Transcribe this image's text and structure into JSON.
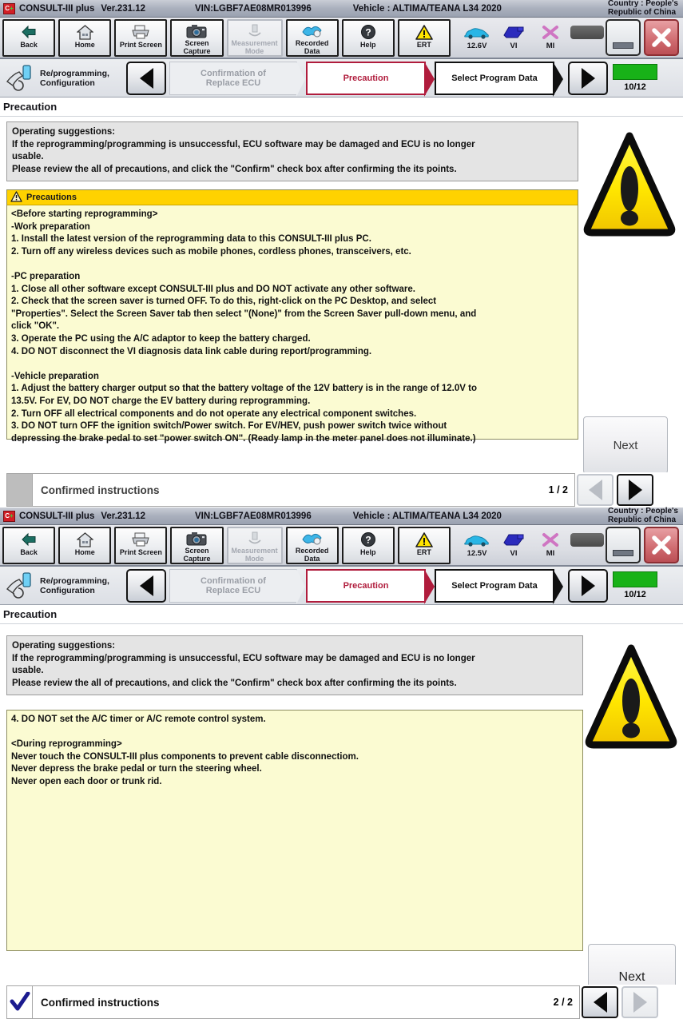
{
  "titlebar": {
    "logo": "c3-logo-icon",
    "app": "CONSULT-III plus",
    "version": "Ver.231.12",
    "vin": "VIN:LGBF7AE08MR013996",
    "vehicle": "Vehicle : ALTIMA/TEANA L34 2020",
    "country_line1": "Country : People's",
    "country_line2": "Republic of China"
  },
  "toolbar": {
    "back": "Back",
    "home": "Home",
    "print_screen": "Print Screen",
    "screen_capture_l1": "Screen",
    "screen_capture_l2": "Capture",
    "measurement_l1": "Measurement",
    "measurement_l2": "Mode",
    "recorded_l1": "Recorded",
    "recorded_l2": "Data",
    "help": "Help",
    "ert": "ERT",
    "voltage_panel1": "12.6V",
    "voltage_panel2": "12.5V",
    "vi": "VI",
    "mi": "MI",
    "minimize": "minimize-button",
    "close": "close-button"
  },
  "flow": {
    "mode_line1": "Re/programming,",
    "mode_line2": "Configuration",
    "prev_label": "previous-step",
    "next_label": "next-step",
    "steps": [
      {
        "line1": "Confirmation of",
        "line2": "Replace ECU",
        "state": "past"
      },
      {
        "line1": "Precaution",
        "line2": "",
        "state": "current"
      },
      {
        "line1": "Select Program Data",
        "line2": "",
        "state": "next"
      }
    ],
    "progress": "10/12",
    "progress_color": "#18b218"
  },
  "page": {
    "title": "Precaution"
  },
  "suggestions": {
    "line1": "Operating  suggestions:",
    "line2": "If the reprogramming/programming is unsuccessful, ECU software may be damaged and ECU is no longer",
    "line3": "usable.",
    "line4": "Please review the all of precautions, and click the \"Confirm\" check box after confirming the its points."
  },
  "precautions": {
    "header": "Precautions",
    "page1": [
      "<Before  starting  reprogramming>",
      "-Work  preparation",
      "1. Install the latest version of the reprogramming data to this CONSULT-III plus PC.",
      "2. Turn off any wireless devices such as mobile phones, cordless phones, transceivers, etc.",
      "",
      "-PC  preparation",
      "1. Close all other software except CONSULT-III plus and DO NOT activate any other software.",
      "2. Check that the screen saver is turned OFF. To do this, right-click on the PC Desktop, and select",
      "\"Properties\". Select the Screen Saver tab then select \"(None)\" from the Screen Saver pull-down menu, and",
      "click \"OK\".",
      "3. Operate the PC using the A/C adaptor to keep the battery charged.",
      "4. DO NOT disconnect the VI diagnosis data link cable during report/programming.",
      "",
      "-Vehicle  preparation",
      "1. Adjust the battery charger output so that the battery voltage of the 12V battery is in the range of 12.0V to",
      "13.5V. For EV, DO NOT charge the EV battery during reprogramming.",
      "2. Turn OFF all electrical components and do not operate any electrical component switches.",
      "3. DO NOT turn OFF the ignition switch/Power switch. For EV/HEV, push power switch twice without",
      "depressing the brake pedal to set \"power switch ON\". (Ready lamp in the meter panel does not illuminate.)"
    ],
    "page2": [
      "4. DO NOT set the A/C timer or A/C remote control system.",
      "",
      "<During  reprogramming>",
      "Never touch the CONSULT-III plus components to prevent cable disconnectiom.",
      "Never depress the brake pedal or turn the steering wheel.",
      "Never open each door or trunk rid."
    ]
  },
  "bottom": {
    "confirm_label": "Confirmed instructions",
    "page1_count": "1 / 2",
    "page2_count": "2 / 2",
    "next_button": "Next",
    "checkbox_panel1_state": "unchecked",
    "checkbox_panel2_state": "checked"
  },
  "colors": {
    "accent_red": "#b01c3c",
    "warning_yellow": "#ffd200",
    "precaution_bg": "#fbfbd2",
    "progress_green": "#18b218"
  }
}
